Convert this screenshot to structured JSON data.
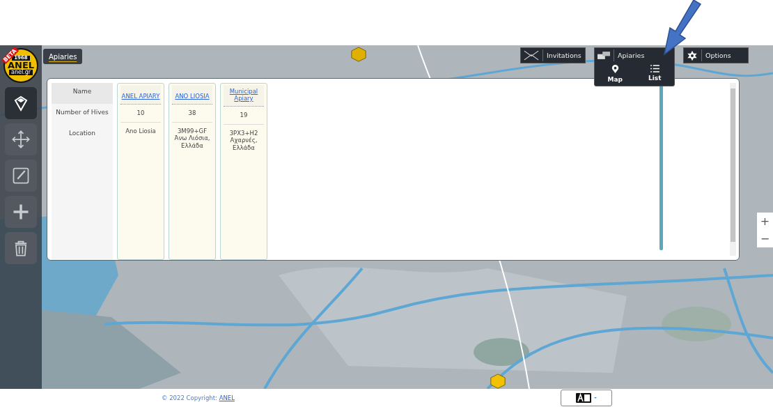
{
  "logo": {
    "badge": "BETA",
    "year": "1968",
    "name": "ANEL",
    "site": "anel.gr"
  },
  "top_tab": {
    "label": "Apiaries",
    "selected": true
  },
  "toolbar": [
    {
      "label": "Invitations",
      "kind": "envelope",
      "expanded": false
    },
    {
      "label": "Apiaries",
      "kind": "apiaries",
      "expanded": true
    },
    {
      "label": "Options",
      "kind": "gear",
      "expanded": false
    }
  ],
  "apiaries_menu": [
    {
      "label": "Map",
      "kind": "pin"
    },
    {
      "label": "List",
      "kind": "list"
    }
  ],
  "tools": [
    {
      "kind": "pin",
      "selected": true
    },
    {
      "kind": "move",
      "selected": false
    },
    {
      "kind": "edit",
      "selected": false
    },
    {
      "kind": "add",
      "selected": false
    },
    {
      "kind": "delete",
      "selected": false
    }
  ],
  "table": {
    "row_labels": [
      "Name",
      "Number of Hives",
      "Location"
    ],
    "columns": [
      {
        "name": "ANEL APIARY",
        "hives": "10",
        "location": "Ano Liosia"
      },
      {
        "name": "ANO LIOSIA",
        "hives": "38",
        "location": "3M99+GF Άνω Λιόσια, Ελλάδα"
      },
      {
        "name": "Municipal Apiary",
        "hives": "19",
        "location": "3PX3+H2 Αχαρνές, Ελλάδα"
      }
    ]
  },
  "zoom_controls": [
    "+",
    "−"
  ],
  "footer": {
    "copyright": "© 2022 Copyright:",
    "link": "ANEL"
  }
}
